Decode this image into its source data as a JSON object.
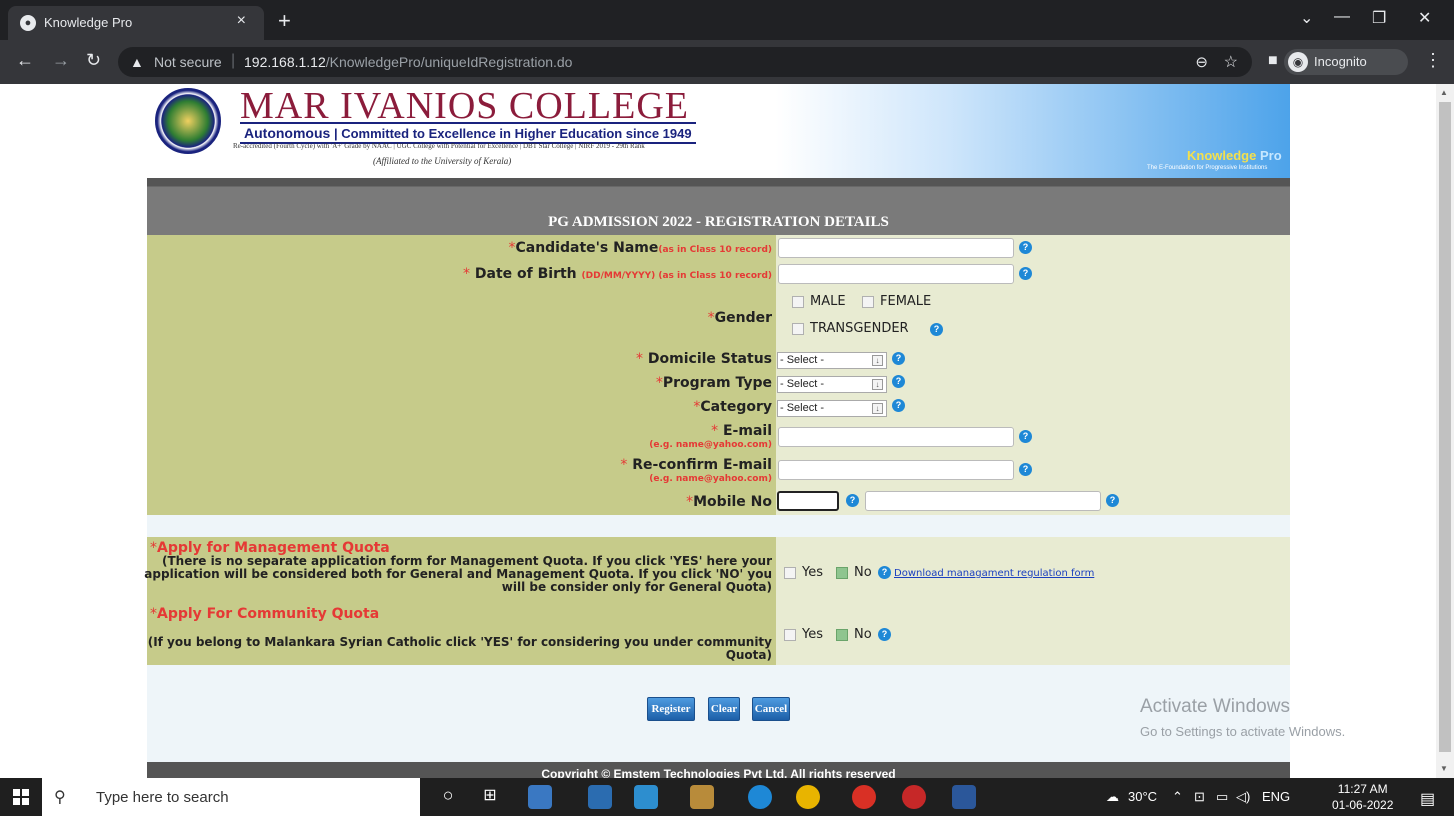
{
  "browser": {
    "tab_title": "Knowledge Pro",
    "tab_close": "×",
    "new_tab": "+",
    "not_secure": "Not secure",
    "url_host": "192.168.1.12",
    "url_path": "/KnowledgePro/uniqueIdRegistration.do",
    "incognito_label": "Incognito"
  },
  "header": {
    "college_name": "MAR IVANIOS COLLEGE",
    "tag_autonomous": "Autonomous",
    "tag_committed": "Committed to Excellence in Higher Education since 1949",
    "accreditation": "Re-accredited (Fourth Cycle) with 'A+' Grade by NAAC | UGC College with Potential for Excellence | DBT Star College | NIRF 2019 - 29th Rank",
    "affiliation": "(Affiliated to the University of Kerala)",
    "kp_knowledge": "Knowledge",
    "kp_pro": "Pro",
    "kp_sub": "The E-Foundation for Progressive Institutions"
  },
  "form": {
    "title": "PG ADMISSION 2022 - REGISTRATION DETAILS",
    "req": "*",
    "help": "?",
    "name_label": "Candidate's Name",
    "name_hint": "(as in Class 10 record)",
    "dob_label": "Date of Birth",
    "dob_hint": "(DD/MM/YYYY) (as in Class 10 record)",
    "gender_label": "Gender",
    "gender_options": [
      "MALE",
      "FEMALE",
      "TRANSGENDER"
    ],
    "domicile_label": "Domicile Status",
    "program_label": "Program Type",
    "category_label": "Category",
    "select_default": "- Select -",
    "email_label": "E-mail",
    "email_hint": "(e.g. name@yahoo.com)",
    "reemail_label": "Re-confirm E-mail",
    "reemail_hint": "(e.g. name@yahoo.com)",
    "mobile_label": "Mobile No",
    "mgmt_title": "Apply for Management Quota",
    "mgmt_note": "(There is no separate application form for Management Quota. If you click 'YES' here your application will be considered both for General and Management Quota. If you click 'NO' you will be consider only for General Quota)",
    "community_title": "Apply For Community Quota",
    "community_note": "(If you belong to Malankara Syrian Catholic click 'YES' for considering you under community Quota)",
    "yes": "Yes",
    "no": "No",
    "download_link": "Download managament regulation form",
    "register": "Register",
    "clear": "Clear",
    "cancel": "Cancel",
    "footer": "Copyright © Emstem Technologies Pvt Ltd. All rights reserved"
  },
  "windows": {
    "activate_title": "Activate Windows",
    "activate_sub": "Go to Settings to activate Windows.",
    "search_placeholder": "Type here to search",
    "weather": "30°C",
    "lang": "ENG",
    "time": "11:27 AM",
    "date": "01-06-2022"
  }
}
